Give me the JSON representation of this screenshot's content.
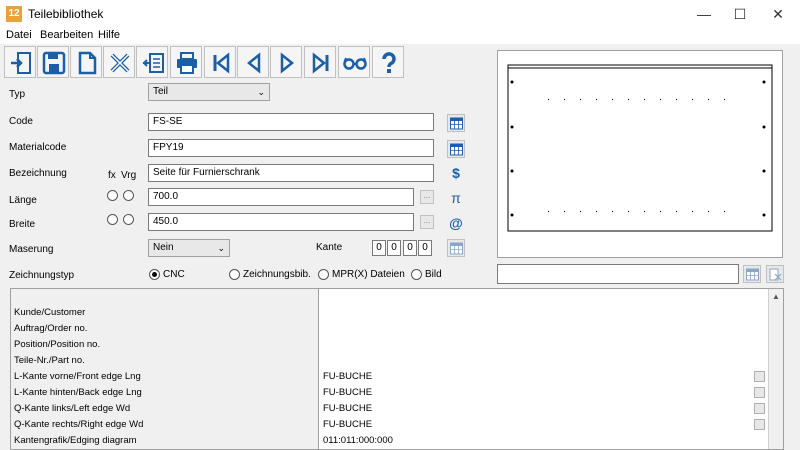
{
  "window": {
    "title": "Teilebibliothek",
    "app_icon_text": "12",
    "minimize": "—",
    "maximize": "☐",
    "close": "✕"
  },
  "menu": {
    "items": [
      "Datei",
      "Bearbeiten",
      "Hilfe"
    ]
  },
  "toolbar": {
    "buttons": [
      {
        "name": "exit-icon",
        "color": "#1a5fa8"
      },
      {
        "name": "save-icon",
        "color": "#1a5fa8"
      },
      {
        "name": "new-document-icon",
        "color": "#1a5fa8"
      },
      {
        "name": "delete-icon",
        "color": "#1a5fa8"
      },
      {
        "name": "import-icon",
        "color": "#1a5fa8"
      },
      {
        "name": "print-icon",
        "color": "#1a5fa8"
      },
      {
        "name": "first-record-icon",
        "color": "#1a5fa8"
      },
      {
        "name": "previous-record-icon",
        "color": "#1a5fa8"
      },
      {
        "name": "next-record-icon",
        "color": "#1a5fa8"
      },
      {
        "name": "last-record-icon",
        "color": "#1a5fa8"
      },
      {
        "name": "glasses-icon",
        "color": "#1a5fa8"
      },
      {
        "name": "help-icon",
        "color": "#1a5fa8"
      }
    ]
  },
  "form": {
    "typ_label": "Typ",
    "typ_value": "Teil",
    "code_label": "Code",
    "code_value": "FS-SE",
    "materialcode_label": "Materialcode",
    "materialcode_value": "FPY19",
    "bezeichnung_label": "Bezeichnung",
    "bezeichnung_value": "Seite für Furnierschrank",
    "fx_label": "fx",
    "vrg_label": "Vrg",
    "laenge_label": "Länge",
    "laenge_value": "700.0",
    "breite_label": "Breite",
    "breite_value": "450.0",
    "maserung_label": "Maserung",
    "maserung_value": "Nein",
    "kante_label": "Kante",
    "kante_values": [
      "0",
      "0",
      "0",
      "0"
    ],
    "dots_label": "...",
    "dollar_glyph": "$",
    "pi_glyph": "π",
    "at_glyph": "@",
    "zeichnungstyp_label": "Zeichnungstyp",
    "zeichnungstyp_options": [
      {
        "label": "CNC",
        "selected": true
      },
      {
        "label": "Zeichnungsbib.",
        "selected": false
      },
      {
        "label": "MPR(X) Dateien",
        "selected": false
      },
      {
        "label": "Bild",
        "selected": false
      }
    ],
    "drawing_path_value": ""
  },
  "grid": {
    "rows": [
      {
        "label": "",
        "value": "",
        "check": false
      },
      {
        "label": "Kunde/Customer",
        "value": "",
        "check": false
      },
      {
        "label": "Auftrag/Order no.",
        "value": "",
        "check": false
      },
      {
        "label": "Position/Position no.",
        "value": "",
        "check": false
      },
      {
        "label": "Teile-Nr./Part no.",
        "value": "",
        "check": false
      },
      {
        "label": "L-Kante vorne/Front edge Lng",
        "value": "FU-BUCHE",
        "check": true
      },
      {
        "label": "L-Kante hinten/Back edge Lng",
        "value": "FU-BUCHE",
        "check": true
      },
      {
        "label": "Q-Kante links/Left edge Wd",
        "value": "FU-BUCHE",
        "check": true
      },
      {
        "label": "Q-Kante rechts/Right edge Wd",
        "value": "FU-BUCHE",
        "check": true
      },
      {
        "label": "Kantengrafik/Edging diagram",
        "value": "011:011:000:000",
        "check": false
      }
    ]
  },
  "colors": {
    "accent": "#1a5fa8",
    "app_icon": "#e8a33d"
  }
}
